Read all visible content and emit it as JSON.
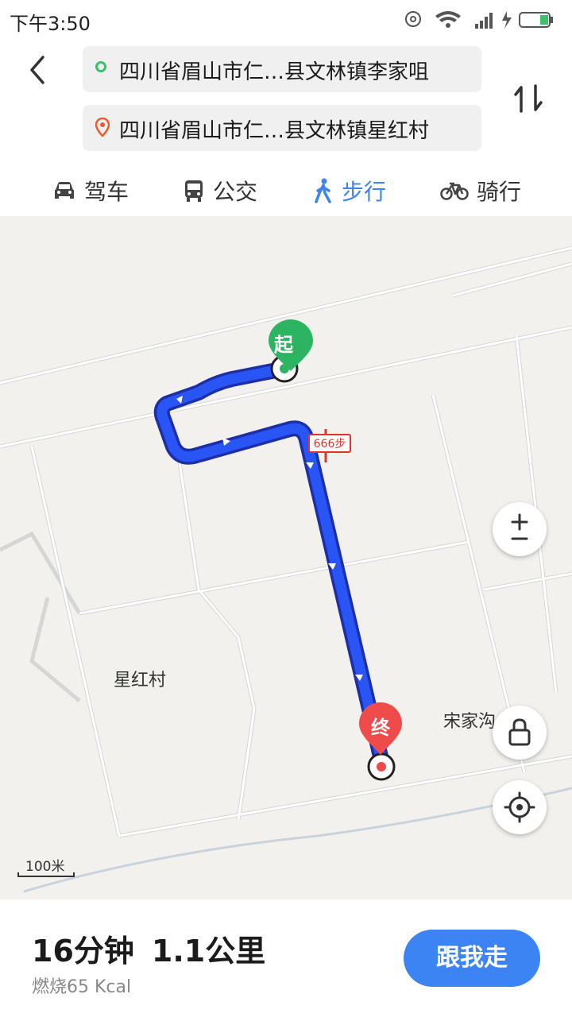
{
  "status_bar": {
    "time": "下午3:50"
  },
  "route": {
    "start": "四川省眉山市仁…县文林镇李家咀",
    "end": "四川省眉山市仁…县文林镇星红村"
  },
  "modes": [
    {
      "label": "驾车",
      "icon": "car-icon"
    },
    {
      "label": "公交",
      "icon": "bus-icon"
    },
    {
      "label": "步行",
      "icon": "walk-icon",
      "active": true
    },
    {
      "label": "骑行",
      "icon": "bike-icon"
    }
  ],
  "map": {
    "start_marker": "起",
    "end_marker": "终",
    "step_badge": "666步",
    "places": [
      "星红村",
      "宋家沟"
    ],
    "scale": "100米",
    "route_color": "#2a55f5"
  },
  "summary": {
    "duration": "16分钟",
    "distance": "1.1公里",
    "calories": "燃烧65 Kcal"
  },
  "follow_button": "跟我走",
  "colors": {
    "accent": "#3c84f3",
    "start": "#2db463",
    "end": "#ef4b4b"
  }
}
